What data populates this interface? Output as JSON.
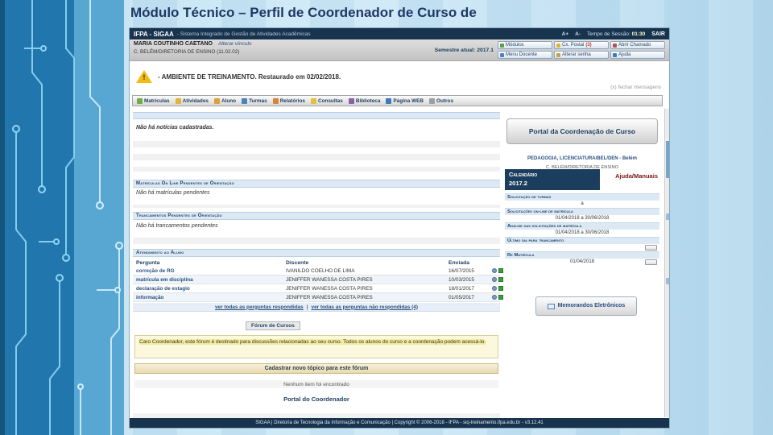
{
  "slide": {
    "title": "Módulo Técnico – Perfil de Coordenador de Curso de"
  },
  "header": {
    "brand": "IFPA - SIGAA",
    "subtitle": "- Sistema Integrado de Gestão de Atividades Acadêmicas",
    "font_increase": "A+",
    "font_decrease": "A-",
    "session_label": "Tempo de Sessão:",
    "session_time": "01:30",
    "logout": "SAIR"
  },
  "userbar": {
    "name": "MARIA COUTINHO CAETANO",
    "change_bond": "Alterar vínculo",
    "unit": "C. BELÉM/DIRETORIA DE ENSINO (11.02.02)",
    "semester_label": "Semestre atual:",
    "semester_value": "2017.1",
    "buttons": [
      {
        "label": "Módulos"
      },
      {
        "label": "Cx. Postal",
        "badge": "(3)"
      },
      {
        "label": "Abrir Chamado"
      },
      {
        "label": "Menu Docente"
      },
      {
        "label": "Alterar senha"
      },
      {
        "label": "Ajuda"
      }
    ]
  },
  "messages": {
    "warning": "- AMBIENTE DE TREINAMENTO. Restaurado em 02/02/2018.",
    "close": "(x) fechar mensagens"
  },
  "menu": {
    "items": [
      {
        "label": "Matrículas"
      },
      {
        "label": "Atividades"
      },
      {
        "label": "Aluno"
      },
      {
        "label": "Turmas"
      },
      {
        "label": "Relatórios"
      },
      {
        "label": "Consultas"
      },
      {
        "label": "Biblioteca"
      },
      {
        "label": "Página WEB"
      },
      {
        "label": "Outros"
      }
    ]
  },
  "main": {
    "news_empty": "Não há notícias cadastradas.",
    "matriculas_title": "Matrículas On Line Pendentes de Orientação",
    "matriculas_empty": "Não há matrículas pendentes",
    "trancamentos_title": "Trancamentos Pendentes de Orientação",
    "trancamentos_empty": "Não há trancamentos pendentes",
    "atendimento_title": "Atendimento ao Aluno",
    "table": {
      "col_pergunta": "Pergunta",
      "col_discente": "Discente",
      "col_enviada": "Enviada",
      "rows": [
        {
          "pergunta": "correção de RG",
          "discente": "IVANILDO COELHO DE LIMA",
          "enviada": "16/07/2015"
        },
        {
          "pergunta": "matrícula em disciplina",
          "discente": "JENIFFER WANESSA COSTA PIRES",
          "enviada": "10/03/2015"
        },
        {
          "pergunta": "declaração de estagio",
          "discente": "JENIFFER WANESSA COSTA PIRES",
          "enviada": "18/01/2017"
        },
        {
          "pergunta": "informação",
          "discente": "JENIFFER WANESSA COSTA PIRES",
          "enviada": "01/05/2017"
        }
      ],
      "link_answered": "ver todas as perguntas respondidas",
      "link_separator": "|",
      "link_unanswered": "ver todas as perguntas não respondidas (4)"
    },
    "forum": {
      "title": "Fórum de Cursos",
      "info": "Caro Coordenador, este fórum é destinado para discussões relacionadas ao seu curso. Todos os alunos do curso e a coordenação podem acessá-lo.",
      "new_topic": "Cadastrar novo tópico para este fórum",
      "empty": "Nenhum item foi encontrado"
    },
    "portal_footer": "Portal do Coordenador"
  },
  "sidebar": {
    "title": "Portal da Coordenação de Curso",
    "course": "PEDAGOGIA, LICENCIATURA/BEL/DEN - Belém",
    "course_unit": "C. BELÉM/DIRETORIA DE ENSINO",
    "calendar_title": "Calendário",
    "calendar_term": "2017.2",
    "help_link": "Ajuda/Manuais",
    "rows": [
      {
        "label": "Solicitação de turmas",
        "value": "a"
      },
      {
        "label": "Solicitações on-line de matrícula",
        "value": "01/04/2018 a 30/06/2018"
      },
      {
        "label": "Análise das solicitações de matrícula",
        "value": "01/04/2018 a 30/06/2018"
      },
      {
        "label": "Último dia para trancamento",
        "value": ""
      },
      {
        "label": "Re Matrícula",
        "value": "01/04/2018"
      }
    ],
    "memo_button": "Memorandos Eletrônicos"
  },
  "footer": {
    "text": "SIGAA | Diretoria de Tecnologia da Informação e Comunicação | Copyright © 2006-2018 - IFPA - siq-treinamento.ifpa.edu.br - v3.12.41"
  },
  "icons": {
    "warning-icon": "yellow-triangle-exclamation",
    "memo-icon": "document-stack",
    "view-answer-icon": "magnifier",
    "reply-icon": "green-reply-square",
    "menu-icons": "small-colored-squares"
  },
  "colors": {
    "header_bg": "#17334e",
    "section_header_bg": "#dce9f5",
    "link_blue": "#2a4f80",
    "warning_yellow": "#f2bb0e",
    "forum_info_bg": "#fcf8dd",
    "calendar_box_bg": "#1c3e5e",
    "help_link_red": "#7c1116",
    "slide_bg": "#cfe9f7",
    "circuit_strip": "#2276ae"
  }
}
